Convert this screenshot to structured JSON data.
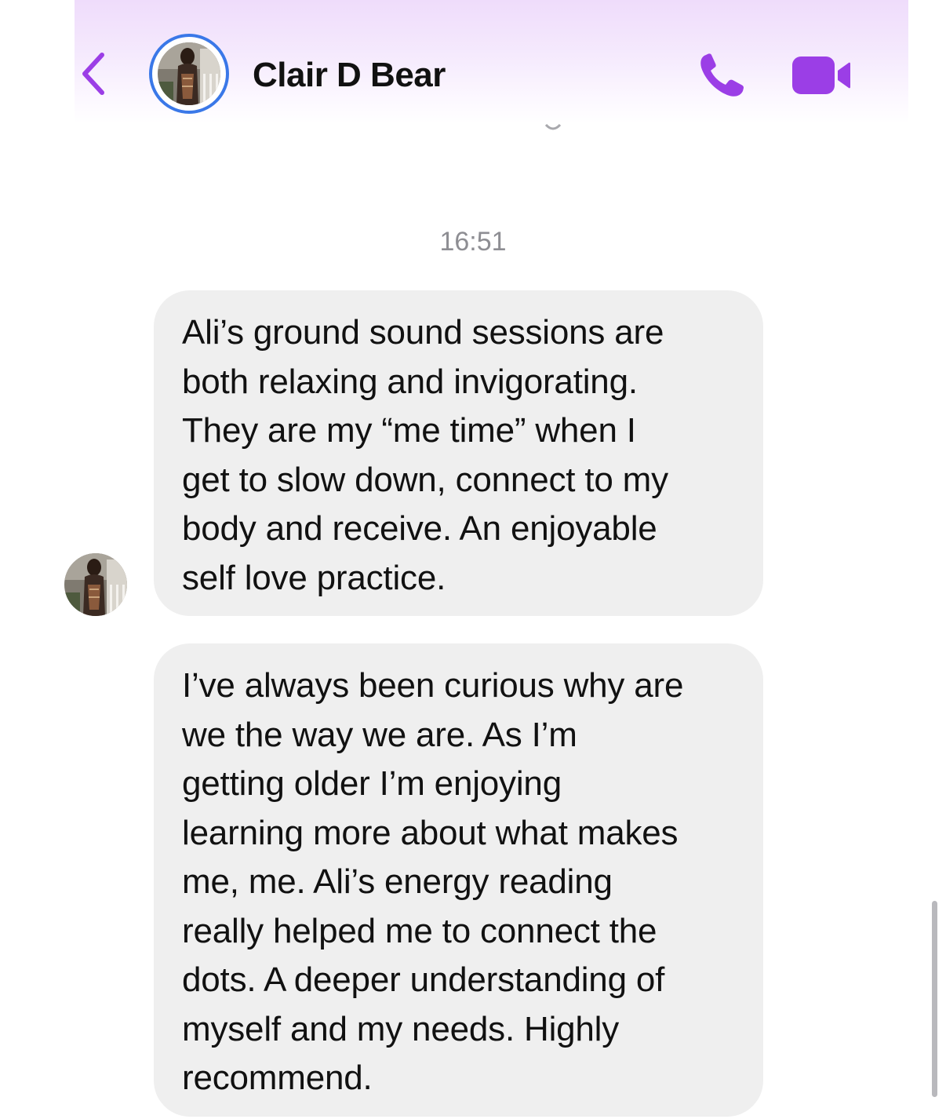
{
  "header": {
    "contact_name": "Clair D Bear",
    "accent_color": "#9b3ee6",
    "avatar_ring_color": "#3a78e8",
    "icons": {
      "back": "chevron-left-icon",
      "call": "phone-icon",
      "video": "video-camera-icon"
    }
  },
  "conversation": {
    "timestamp": "16:51",
    "messages": [
      {
        "sender": "Clair D Bear",
        "lines": [
          "Ali’s ground sound sessions are",
          "both relaxing and invigorating.",
          "They are my “me time” when I",
          "get to slow down, connect to my",
          "body and receive. An enjoyable",
          "self love practice."
        ]
      },
      {
        "sender": "Clair D Bear",
        "lines": [
          "I’ve always been curious why are",
          "we the way we are. As I’m",
          "getting older I’m enjoying",
          "learning more about what makes",
          "me, me. Ali’s energy reading",
          "really helped me to connect the",
          "dots. A deeper understanding of",
          "myself and my needs. Highly",
          "recommend."
        ]
      }
    ]
  },
  "colors": {
    "incoming_bubble": "#efefef",
    "timestamp_text": "#8e8e93",
    "header_gradient_top": "#efdcfb"
  }
}
